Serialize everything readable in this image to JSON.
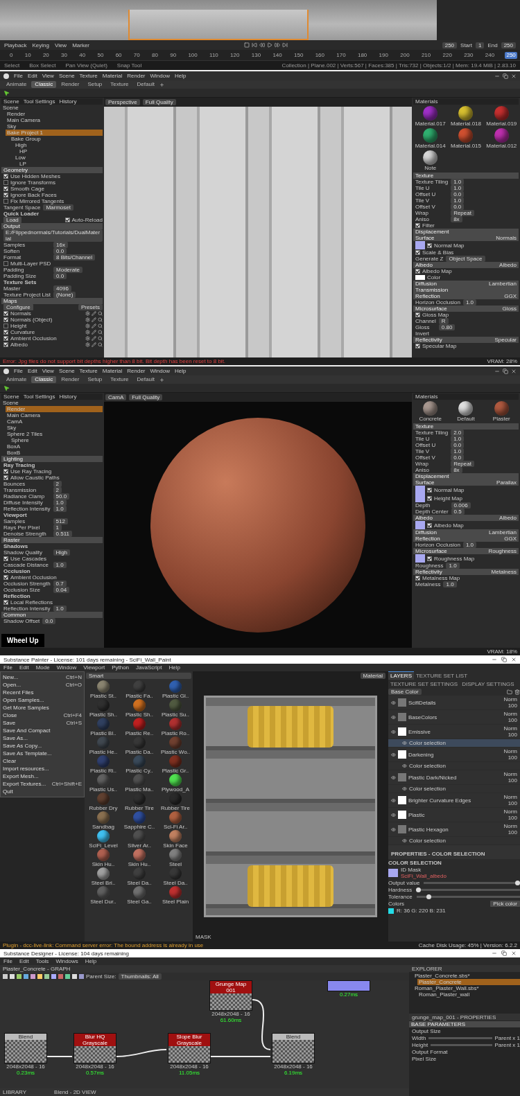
{
  "timeline": {
    "menus": [
      "Playback",
      "Keying",
      "View",
      "Marker"
    ],
    "frame": "250",
    "start_label": "Start",
    "start": "1",
    "end_label": "End",
    "end": "250",
    "ticks": [
      {
        "label": "0",
        "selected": false
      },
      {
        "label": "10",
        "selected": false
      },
      {
        "label": "20",
        "selected": false
      },
      {
        "label": "30",
        "selected": false
      },
      {
        "label": "40",
        "selected": false
      },
      {
        "label": "50",
        "selected": false
      },
      {
        "label": "60",
        "selected": false
      },
      {
        "label": "70",
        "selected": false
      },
      {
        "label": "80",
        "selected": false
      },
      {
        "label": "90",
        "selected": false
      },
      {
        "label": "100",
        "selected": false
      },
      {
        "label": "110",
        "selected": false
      },
      {
        "label": "120",
        "selected": false
      },
      {
        "label": "130",
        "selected": false
      },
      {
        "label": "140",
        "selected": false
      },
      {
        "label": "150",
        "selected": false
      },
      {
        "label": "160",
        "selected": false
      },
      {
        "label": "170",
        "selected": false
      },
      {
        "label": "180",
        "selected": false
      },
      {
        "label": "190",
        "selected": false
      },
      {
        "label": "200",
        "selected": false
      },
      {
        "label": "210",
        "selected": false
      },
      {
        "label": "220",
        "selected": false
      },
      {
        "label": "230",
        "selected": false
      },
      {
        "label": "240",
        "selected": false
      },
      {
        "label": "250",
        "selected": true
      }
    ],
    "status": [
      "Select",
      "Box Select",
      "Pan View (Quiet)",
      "Snap Tool"
    ],
    "stats": "Collection | Plane.002 | Verts:567 | Faces:385 | Tris:732 | Objects:1/2 | Mem: 19.4 MiB | 2.83.10"
  },
  "toolbag": [
    {
      "menus": [
        "File",
        "Edit",
        "View",
        "Scene",
        "Texture",
        "Material",
        "Render",
        "Window",
        "Help"
      ],
      "tabs": [
        {
          "label": "Animate",
          "selected": false
        },
        {
          "label": "Classic",
          "selected": true
        },
        {
          "label": "Render",
          "selected": false
        },
        {
          "label": "Setup",
          "selected": false
        },
        {
          "label": "Texture",
          "selected": false
        },
        {
          "label": "Default",
          "selected": false
        }
      ],
      "panel_tabs": [
        "Scene",
        "Tool Settings",
        "History"
      ],
      "tree": [
        {
          "label": "Scene",
          "selected": false,
          "children": [
            {
              "label": "Render",
              "selected": false
            },
            {
              "label": "Main Camera",
              "selected": false
            },
            {
              "label": "Sky",
              "selected": false
            },
            {
              "label": "Bake Project 1",
              "selected": true,
              "children": [
                {
                  "label": "Bake Group",
                  "selected": false,
                  "children": [
                    {
                      "label": "High",
                      "selected": false,
                      "children": [
                        {
                          "label": "HP",
                          "selected": false
                        }
                      ]
                    },
                    {
                      "label": "Low",
                      "selected": false,
                      "children": [
                        {
                          "label": "LP",
                          "selected": false
                        }
                      ]
                    }
                  ]
                }
              ]
            }
          ]
        }
      ],
      "sections": [
        {
          "title": "Geometry",
          "rows": [
            {
              "kind": "check",
              "text": "Use Hidden Meshes",
              "checked": true
            },
            {
              "kind": "check",
              "text": "Ignore Transforms",
              "checked": false
            },
            {
              "kind": "check",
              "text": "Smooth Cage",
              "checked": true
            },
            {
              "kind": "check",
              "text": "Ignore Back Faces",
              "checked": true
            },
            {
              "kind": "check",
              "text": "Fix Mirrored Tangents",
              "checked": false
            },
            {
              "kind": "field",
              "label": "Tangent Space",
              "value": "Marmoset"
            },
            {
              "kind": "header",
              "text": "Quick Loader"
            },
            {
              "kind": "button",
              "text": "Load",
              "check_text": "Auto-Reload",
              "checked": true
            }
          ]
        },
        {
          "title": "Output",
          "rows": [
            {
              "kind": "path",
              "value": "E:/Flippednormals/Tutorials/DualMaterial"
            },
            {
              "kind": "field",
              "label": "Samples",
              "value": "16x"
            },
            {
              "kind": "field",
              "label": "Soften",
              "value": "0.0"
            },
            {
              "kind": "field",
              "label": "Format",
              "value": "8 Bits/Channel"
            },
            {
              "kind": "check",
              "text": "Multi-Layer PSD",
              "checked": false
            },
            {
              "kind": "field",
              "label": "Padding",
              "value": "Moderate"
            },
            {
              "kind": "field",
              "label": "Padding Size",
              "value": "0.0"
            },
            {
              "kind": "header",
              "text": "Texture Sets"
            },
            {
              "kind": "field",
              "label": "Master",
              "value": "4096"
            },
            {
              "kind": "field",
              "label": "Texture Project List",
              "value": "(None)"
            }
          ]
        },
        {
          "title": "Maps",
          "rows": [
            {
              "kind": "button",
              "text": "Configure",
              "value": "Presets"
            },
            {
              "kind": "map",
              "text": "Normals",
              "checked": true
            },
            {
              "kind": "map",
              "text": "Normals (Object)",
              "checked": true
            },
            {
              "kind": "map",
              "text": "Height",
              "checked": false
            },
            {
              "kind": "map",
              "text": "Curvature",
              "checked": true
            },
            {
              "kind": "map",
              "text": "Ambient Occlusion",
              "checked": true
            },
            {
              "kind": "map",
              "text": "Albedo",
              "checked": true
            }
          ]
        }
      ],
      "viewport": {
        "kind": "panel",
        "camera": "Perspective",
        "quality": "Full Quality"
      },
      "materials_title": "Materials",
      "materials": [
        {
          "name": "Material.017",
          "color": "#a030c8"
        },
        {
          "name": "Material.018",
          "color": "#d8c030"
        },
        {
          "name": "Material.019",
          "color": "#c83030"
        },
        {
          "name": "Material.014",
          "color": "#30b070"
        },
        {
          "name": "Material.015",
          "color": "#d05030"
        },
        {
          "name": "Material.012",
          "color": "#c030b0"
        },
        {
          "name": "Note",
          "color": "#d8d8d8"
        }
      ],
      "right_sections": [
        {
          "title": "Texture",
          "rows": [
            {
              "kind": "field",
              "label": "Texture Tiling",
              "value": "1.0"
            },
            {
              "kind": "field",
              "label": "Tile U",
              "value": "1.0"
            },
            {
              "kind": "field",
              "label": "Offset U",
              "value": "0.0"
            },
            {
              "kind": "field",
              "label": "Tile V",
              "value": "1.0"
            },
            {
              "kind": "field",
              "label": "Offset V",
              "value": "0.0"
            },
            {
              "kind": "field",
              "label": "Wrap",
              "value": "Repeat"
            },
            {
              "kind": "field",
              "label": "Aniso",
              "value": "8x"
            },
            {
              "kind": "check",
              "text": "Filter",
              "checked": true
            }
          ]
        },
        {
          "title": "Displacement"
        },
        {
          "title": "Surface",
          "value": "Normals",
          "rows": [
            {
              "kind": "swatch_check",
              "text": "Normal Map",
              "checked": true
            },
            {
              "kind": "check",
              "text": "Scale & Bias",
              "checked": true
            },
            {
              "kind": "field",
              "label": "Generate Z",
              "value": "Object Space"
            }
          ]
        },
        {
          "title": "Albedo",
          "value": "Albedo",
          "rows": [
            {
              "kind": "check",
              "text": "Albedo Map",
              "checked": true
            },
            {
              "kind": "color",
              "text": "Color"
            }
          ]
        },
        {
          "title": "Diffusion",
          "value": "Lambertian"
        },
        {
          "title": "Transmission"
        },
        {
          "title": "Reflection",
          "value": "GGX",
          "rows": [
            {
              "kind": "field",
              "label": "Horizon Occlusion",
              "value": "1.0"
            }
          ]
        },
        {
          "title": "Microsurface",
          "value": "Gloss",
          "rows": [
            {
              "kind": "check",
              "text": "Gloss Map",
              "checked": true
            },
            {
              "kind": "field",
              "label": "Channel",
              "value": "R"
            },
            {
              "kind": "field",
              "label": "Gloss",
              "value": "0.80"
            },
            {
              "kind": "label",
              "text": "Invert"
            }
          ]
        },
        {
          "title": "Reflectivity",
          "value": "Specular",
          "rows": [
            {
              "kind": "check",
              "text": "Specular Map",
              "checked": true
            }
          ]
        }
      ],
      "error": "Error: Jpg files do not support bit depths higher than 8 bit. Bit depth has been reset to 8 bit.",
      "vram": "VRAM: 28%"
    },
    {
      "menus": [
        "File",
        "Edit",
        "View",
        "Scene",
        "Texture",
        "Material",
        "Render",
        "Window",
        "Help"
      ],
      "tabs": [
        {
          "label": "Animate",
          "selected": false
        },
        {
          "label": "Classic",
          "selected": true
        },
        {
          "label": "Render",
          "selected": false
        },
        {
          "label": "Setup",
          "selected": false
        },
        {
          "label": "Texture",
          "selected": false
        },
        {
          "label": "Default",
          "selected": false
        }
      ],
      "panel_tabs": [
        "Scene",
        "Tool Settings",
        "History"
      ],
      "tree": [
        {
          "label": "Scene",
          "selected": false,
          "children": [
            {
              "label": "Render",
              "selected": true
            },
            {
              "label": "Main Camera",
              "selected": false
            },
            {
              "label": "CamA",
              "selected": false
            },
            {
              "label": "Sky",
              "selected": false
            },
            {
              "label": "Sphere 2 Tiles",
              "selected": false,
              "children": [
                {
                  "label": "Sphere",
                  "selected": false
                }
              ]
            },
            {
              "label": "BoxA",
              "selected": false
            },
            {
              "label": "BoxB",
              "selected": false
            }
          ]
        }
      ],
      "sections": [
        {
          "title": "Lighting",
          "rows": [
            {
              "kind": "header",
              "text": "Ray Tracing"
            },
            {
              "kind": "check",
              "text": "Use Ray Tracing",
              "checked": true
            },
            {
              "kind": "check",
              "text": "Allow Caustic Paths",
              "checked": true
            },
            {
              "kind": "field",
              "label": "Bounces",
              "value": "2"
            },
            {
              "kind": "field",
              "label": "Transmission",
              "value": "2"
            },
            {
              "kind": "field",
              "label": "Radiance Clamp",
              "value": "50.0"
            },
            {
              "kind": "field",
              "label": "Diffuse Intensity",
              "value": "1.0"
            },
            {
              "kind": "field",
              "label": "Reflection Intensity",
              "value": "1.0"
            },
            {
              "kind": "header",
              "text": "Viewport"
            },
            {
              "kind": "field",
              "label": "Samples",
              "value": "512"
            },
            {
              "kind": "field",
              "label": "Rays Per Pixel",
              "value": "1"
            },
            {
              "kind": "field",
              "label": "Denoise Strength",
              "value": "0.511"
            }
          ]
        },
        {
          "title": "Raster",
          "rows": [
            {
              "kind": "header",
              "text": "Shadows"
            },
            {
              "kind": "field",
              "label": "Shadow Quality",
              "value": "High"
            },
            {
              "kind": "check",
              "text": "Use Cascades",
              "checked": true
            },
            {
              "kind": "field",
              "label": "Cascade Distance",
              "value": "1.0"
            },
            {
              "kind": "header",
              "text": "Occlusion"
            },
            {
              "kind": "check",
              "text": "Ambient Occlusion",
              "checked": true
            },
            {
              "kind": "field",
              "label": "Occlusion Strength",
              "value": "0.7"
            },
            {
              "kind": "field",
              "label": "Occlusion Size",
              "value": "0.04"
            },
            {
              "kind": "header",
              "text": "Reflection"
            },
            {
              "kind": "check",
              "text": "Local Reflections",
              "checked": true
            },
            {
              "kind": "field",
              "label": "Reflection Intensity",
              "value": "1.0"
            }
          ]
        },
        {
          "title": "Common",
          "rows": [
            {
              "kind": "field",
              "label": "Shadow Offset",
              "value": "0.0"
            }
          ]
        }
      ],
      "viewport": {
        "kind": "sphere",
        "camera": "CamA",
        "quality": "Full Quality"
      },
      "materials_title": "Materials",
      "materials": [
        {
          "name": "Concrete",
          "color": "#a89890"
        },
        {
          "name": "Default",
          "color": "#e0e0e0"
        },
        {
          "name": "Plaster",
          "color": "#b05a40"
        }
      ],
      "right_sections": [
        {
          "title": "Texture",
          "rows": [
            {
              "kind": "field",
              "label": "Texture Tiling",
              "value": "2.0"
            },
            {
              "kind": "field",
              "label": "Tile U",
              "value": "1.0"
            },
            {
              "kind": "field",
              "label": "Offset U",
              "value": "0.0"
            },
            {
              "kind": "field",
              "label": "Tile V",
              "value": "1.0"
            },
            {
              "kind": "field",
              "label": "Offset V",
              "value": "0.0"
            },
            {
              "kind": "field",
              "label": "Wrap",
              "value": "Repeat"
            },
            {
              "kind": "field",
              "label": "Aniso",
              "value": "8x"
            }
          ]
        },
        {
          "title": "Displacement"
        },
        {
          "title": "Surface",
          "value": "Parallax",
          "rows": [
            {
              "kind": "swatch_check",
              "text": "Normal Map",
              "checked": true
            },
            {
              "kind": "swatch_check",
              "text": "Height Map",
              "checked": true
            },
            {
              "kind": "field",
              "label": "Depth",
              "value": "0.006"
            },
            {
              "kind": "field",
              "label": "Depth Center",
              "value": "0.5"
            }
          ]
        },
        {
          "title": "Albedo",
          "value": "Albedo",
          "rows": [
            {
              "kind": "swatch_check",
              "text": "Albedo Map",
              "checked": true
            }
          ]
        },
        {
          "title": "Diffusion",
          "value": "Lambertian"
        },
        {
          "title": "Reflection",
          "value": "GGX",
          "rows": [
            {
              "kind": "field",
              "label": "Horizon Occlusion",
              "value": "1.0"
            }
          ]
        },
        {
          "title": "Microsurface",
          "value": "Roughness",
          "rows": [
            {
              "kind": "swatch_check",
              "text": "Roughness Map",
              "checked": true
            },
            {
              "kind": "field",
              "label": "Roughness",
              "value": "1.0"
            }
          ]
        },
        {
          "title": "Reflectivity",
          "value": "Metalness",
          "rows": [
            {
              "kind": "check",
              "text": "Metalness Map",
              "checked": true
            },
            {
              "kind": "field",
              "label": "Metalness",
              "value": "1.0"
            }
          ]
        }
      ],
      "vram": "VRAM: 18%",
      "overlay": "Wheel Up"
    }
  ],
  "painter": {
    "title": "Substance Painter - License: 101 days remaining - SciFi_Wall_Paint",
    "menus": [
      "File",
      "Edit",
      "Mode",
      "Window",
      "Viewport",
      "Python",
      "JavaScript",
      "Help"
    ],
    "file_menu": [
      {
        "label": "New...",
        "shortcut": "Ctrl+N"
      },
      {
        "label": "Open...",
        "shortcut": "Ctrl+O"
      },
      {
        "label": "Recent Files"
      },
      {
        "label": "Open Samples..."
      },
      {
        "label": "Get More Samples"
      },
      {
        "label": "Close",
        "shortcut": "Ctrl+F4"
      },
      {
        "label": "Save",
        "shortcut": "Ctrl+S"
      },
      {
        "label": "Save And Compact"
      },
      {
        "label": "Save As..."
      },
      {
        "label": "Save As Copy..."
      },
      {
        "label": "Save As Template..."
      },
      {
        "label": "Clear"
      },
      {
        "label": "Import resources..."
      },
      {
        "label": "Export Mesh..."
      },
      {
        "label": "Export Textures...",
        "shortcut": "Ctrl+Shift+E"
      },
      {
        "label": "Quit"
      }
    ],
    "search": "Smart",
    "shelf": [
      {
        "name": "Plastic St..",
        "color": "#8a8470"
      },
      {
        "name": "Plastic Fa..",
        "color": "#404040"
      },
      {
        "name": "Plastic Gl..",
        "color": "#3060b0"
      },
      {
        "name": "Plastic Sh..",
        "color": "#303030"
      },
      {
        "name": "Plastic Sh..",
        "color": "#d07020"
      },
      {
        "name": "Plastic Su..",
        "color": "#505a40"
      },
      {
        "name": "Plastic Bl..",
        "color": "#304060"
      },
      {
        "name": "Plastic Re..",
        "color": "#c02020"
      },
      {
        "name": "Plastic Ro..",
        "color": "#b03030"
      },
      {
        "name": "Plastic He..",
        "color": "#404850"
      },
      {
        "name": "Plastic Da..",
        "color": "#383838"
      },
      {
        "name": "Plastic Wo..",
        "color": "#704030"
      },
      {
        "name": "Plastic Ri..",
        "color": "#304070"
      },
      {
        "name": "Plastic Cy..",
        "color": "#3a4a5a"
      },
      {
        "name": "Plastic Gr..",
        "color": "#803020"
      },
      {
        "name": "Plastic Us..",
        "color": "#606060"
      },
      {
        "name": "Plastic Ma..",
        "color": "#505050"
      },
      {
        "name": "Plywood_A",
        "color": "#50e050"
      },
      {
        "name": "Rubber Dry",
        "color": "#604030"
      },
      {
        "name": "Rubber Tire",
        "color": "#303030"
      },
      {
        "name": "Rubber Tire",
        "color": "#2a2a2a"
      },
      {
        "name": "Sandbag",
        "color": "#8a7050"
      },
      {
        "name": "Sapphire C..",
        "color": "#3050a0"
      },
      {
        "name": "Sci-Fi Ar..",
        "color": "#b06040"
      },
      {
        "name": "SciFi_Level",
        "color": "#40c0f0"
      },
      {
        "name": "Silver Ar..",
        "color": "#505050"
      },
      {
        "name": "Skin Face",
        "color": "#c08060"
      },
      {
        "name": "Skin Hu..",
        "color": "#b06050"
      },
      {
        "name": "Skin Hu..",
        "color": "#c07060"
      },
      {
        "name": "Steel",
        "color": "#808080"
      },
      {
        "name": "Steel Bri..",
        "color": "#a0a0a0"
      },
      {
        "name": "Steel Da..",
        "color": "#404040"
      },
      {
        "name": "Steel Da..",
        "color": "#383838"
      },
      {
        "name": "Steel Dur..",
        "color": "#606060"
      },
      {
        "name": "Steel Ga..",
        "color": "#707070"
      },
      {
        "name": "Steel Plain",
        "color": "#c03030"
      }
    ],
    "viewport_label": "Material",
    "view_name": "MASK",
    "panel_tabs": [
      {
        "label": "LAYERS",
        "selected": true
      },
      {
        "label": "TEXTURE SET LIST",
        "selected": false
      },
      {
        "label": "TEXTURE SET SETTINGS",
        "selected": false
      },
      {
        "label": "DISPLAY SETTINGS",
        "selected": false
      }
    ],
    "channel": "Base Color",
    "layers": [
      {
        "kind": "folder",
        "name": "ScifiDetails",
        "blend": "Norm",
        "opacity": "100",
        "selected": false
      },
      {
        "kind": "folder",
        "name": "BaseColors",
        "blend": "Norm",
        "opacity": "100",
        "selected": false
      },
      {
        "kind": "fill",
        "name": "Emissive",
        "blend": "Norm",
        "opacity": "100",
        "selected": false
      },
      {
        "kind": "mask",
        "name": "Color selection",
        "selected": true
      },
      {
        "kind": "fill",
        "name": "Darkening",
        "blend": "Norm",
        "opacity": "100",
        "selected": false
      },
      {
        "kind": "mask",
        "name": "Color selection",
        "selected": false
      },
      {
        "kind": "folder",
        "name": "Plastic Dark/Nicked",
        "blend": "Norm",
        "opacity": "100",
        "selected": false
      },
      {
        "kind": "mask",
        "name": "Color selection",
        "selected": false
      },
      {
        "kind": "fill",
        "name": "Brighter Curvature Edges",
        "blend": "Norm",
        "opacity": "100",
        "selected": false
      },
      {
        "kind": "fill",
        "name": "Plastic",
        "blend": "Norm",
        "opacity": "100",
        "selected": false
      },
      {
        "kind": "folder",
        "name": "Plastic Hexagon",
        "blend": "Norm",
        "opacity": "100",
        "selected": false
      },
      {
        "kind": "mask",
        "name": "Color selection",
        "selected": false
      }
    ],
    "props_title": "PROPERTIES - COLOR SELECTION",
    "props_heading": "COLOR SELECTION",
    "id_mask": "ID Mask",
    "id_map": "SciFi_Wall_albedo",
    "sliders": [
      {
        "label": "Output value",
        "level": 1.0
      },
      {
        "label": "Hardness",
        "level": 0.0
      },
      {
        "label": "Tolerance",
        "level": 0.1
      }
    ],
    "colors_label": "Colors",
    "pick": "Pick color",
    "rgb": "R: 36   G: 220   B: 231",
    "status": "Plugin - dcc-live-link: Command server error: The bound address is already in use",
    "cache": "Cache Disk Usage: 45% | Version: 6.2.2"
  },
  "designer": {
    "title": "Substance Designer - License: 104 days remaining",
    "menus": [
      "File",
      "Edit",
      "Tools",
      "Windows",
      "Help"
    ],
    "graph_title": "Plaster_Concrete - GRAPH",
    "parent_size": "Parent Size:",
    "thumbnails": "Thumbnails: All",
    "nodes": [
      {
        "kind": "gray",
        "title": "Blend",
        "size": "2048x2048 - 16",
        "time": "0.23ms"
      },
      {
        "kind": "red",
        "title": "Blur HQ Grayscale",
        "size": "2048x2048 - 16",
        "time": "0.57ms"
      },
      {
        "kind": "red",
        "title": "Slope Blur Grayscale",
        "size": "2048x2048 - 16",
        "time": "11.05ms"
      },
      {
        "kind": "gray",
        "title": "Blend",
        "size": "2048x2048 - 16",
        "time": "6.19ms"
      },
      {
        "kind": "red",
        "title": "Grunge Map 001",
        "size": "2048x2048 - 16",
        "time": "61.60ms"
      },
      {
        "kind": "color",
        "time": "0.27ms"
      }
    ],
    "explorer_title": "EXPLORER",
    "explorer": [
      {
        "label": "Plaster_Concrete.sbs*",
        "selected": false,
        "children": [
          {
            "label": "Plaster_Concrete",
            "selected": true
          }
        ]
      },
      {
        "label": "Roman_Plaster_Wall.sbs*",
        "selected": false,
        "children": [
          {
            "label": "Roman_Plaster_wall",
            "selected": false
          }
        ]
      }
    ],
    "props_title": "grunge_map_001 - PROPERTIES",
    "props_heading": "BASE PARAMETERS",
    "output_size": "Output Size",
    "width": "Width",
    "height": "Height",
    "width_value": "Parent x 1",
    "height_value": "Parent x 1",
    "output_format": "Output Format",
    "pixel_size": "Pixel Size",
    "library": "LIBRARY",
    "view2d": "Blend - 2D VIEW"
  }
}
